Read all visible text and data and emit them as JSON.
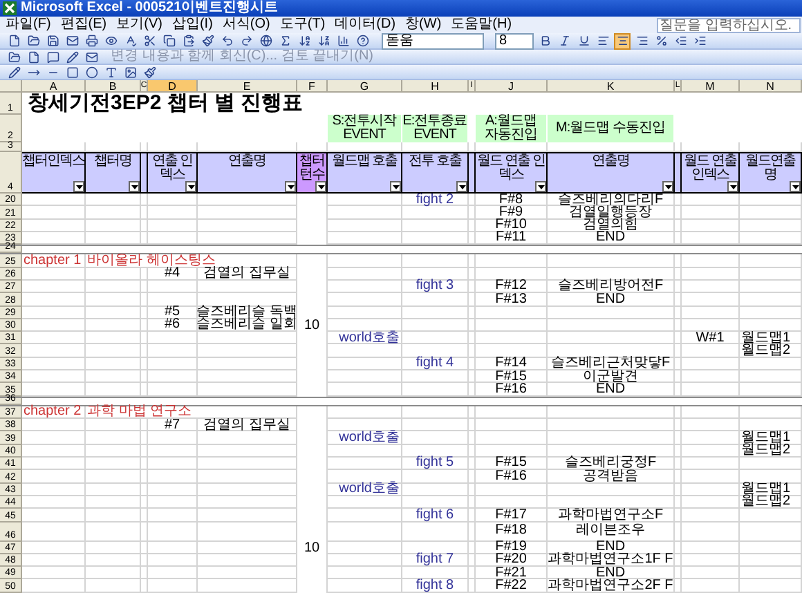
{
  "window": {
    "title": "Microsoft Excel - 000521이벤트진행시트"
  },
  "menu": [
    "파일(F)",
    "편집(E)",
    "보기(V)",
    "삽입(I)",
    "서식(O)",
    "도구(T)",
    "데이터(D)",
    "창(W)",
    "도움말(H)"
  ],
  "help_box": {
    "placeholder": "질문을 입력하십시오."
  },
  "formatting": {
    "font": "돋움",
    "size": "8",
    "align_center_active": true
  },
  "review_toolbar": {
    "reply": "변경 내용과 함께 회신(C)... 검토 끝내기(N)",
    "disabled": true
  },
  "columns": [
    {
      "label": "A",
      "selected": false
    },
    {
      "label": "B",
      "selected": false
    },
    {
      "label": "C",
      "selected": false
    },
    {
      "label": "D",
      "selected": true
    },
    {
      "label": "E",
      "selected": false
    },
    {
      "label": "F",
      "selected": false
    },
    {
      "label": "G",
      "selected": false
    },
    {
      "label": "H",
      "selected": false
    },
    {
      "label": "I",
      "selected": false
    },
    {
      "label": "J",
      "selected": false
    },
    {
      "label": "K",
      "selected": false
    },
    {
      "label": "L",
      "selected": false
    },
    {
      "label": "M",
      "selected": false
    },
    {
      "label": "N",
      "selected": false
    }
  ],
  "rows": [
    {
      "number": "1",
      "kind": "title",
      "cells": {
        "A": "창세기전3EP2 챕터 별 진행표"
      }
    },
    {
      "number": "2",
      "kind": "legend",
      "cells": {
        "G": "S:전투시작 EVENT",
        "H": "E:전투종료 EVENT",
        "J": "A:월드맵 자동진입",
        "K": "M:월드맵 수동진입"
      }
    },
    {
      "number": "3",
      "kind": "blank",
      "cells": {}
    },
    {
      "number": "4",
      "kind": "header",
      "cells": {
        "A": "챕터인덱스",
        "B": "챕터명",
        "D": "연출 인덱스",
        "E": "연출명",
        "F": "챕터턴수",
        "G": "월드맵 호출",
        "H": "전투 호출",
        "J": "월드 연출 인덱스",
        "K": "연출명",
        "M": "월드 연출 인덱스",
        "N": "월드연출명"
      }
    },
    {
      "number": "20",
      "kind": "normal",
      "cells": {
        "H": "fight 2",
        "J": "F#8",
        "K": "슬즈베리의다리F"
      }
    },
    {
      "number": "21",
      "kind": "normal",
      "cells": {
        "J": "F#9",
        "K": "검열일행등장"
      }
    },
    {
      "number": "22",
      "kind": "normal",
      "cells": {
        "J": "F#10",
        "K": "검열의힘"
      }
    },
    {
      "number": "23",
      "kind": "normal",
      "cells": {
        "J": "F#11",
        "K": "END"
      }
    },
    {
      "number": "24",
      "kind": "separator",
      "cells": {}
    },
    {
      "number": "25",
      "kind": "normal",
      "cells": {
        "A": "chapter 1",
        "B": "바이올라 헤이스팅스"
      }
    },
    {
      "number": "26",
      "kind": "normal",
      "cells": {
        "D": "#4",
        "E": "검열의 집무실"
      }
    },
    {
      "number": "27",
      "kind": "normal",
      "cells": {
        "H": "fight 3",
        "J": "F#12",
        "K": "슬즈베리방어전F"
      }
    },
    {
      "number": "28",
      "kind": "normal",
      "cells": {
        "J": "F#13",
        "K": "END"
      }
    },
    {
      "number": "29",
      "kind": "normal",
      "cells": {
        "D": "#5",
        "E": "슬즈베리슬 독백"
      }
    },
    {
      "number": "30",
      "kind": "normal",
      "cells": {
        "D": "#6",
        "E": "슬즈베리슬 일회",
        "F": "10"
      }
    },
    {
      "number": "31",
      "kind": "normal",
      "cells": {
        "G": "world호출",
        "M": "W#1",
        "N": "월드맵1"
      }
    },
    {
      "number": "32",
      "kind": "normal",
      "cells": {
        "N": "월드맵2"
      }
    },
    {
      "number": "33",
      "kind": "normal",
      "cells": {
        "H": "fight 4",
        "J": "F#14",
        "K": "슬즈베리근처맞닿F"
      }
    },
    {
      "number": "34",
      "kind": "normal",
      "cells": {
        "J": "F#15",
        "K": "이군발견"
      }
    },
    {
      "number": "35",
      "kind": "normal",
      "cells": {
        "J": "F#16",
        "K": "END"
      }
    },
    {
      "number": "36",
      "kind": "separator",
      "cells": {}
    },
    {
      "number": "37",
      "kind": "normal",
      "cells": {
        "A": "chapter 2",
        "B": "과학 마법 연구소"
      }
    },
    {
      "number": "38",
      "kind": "normal",
      "cells": {
        "D": "#7",
        "E": "검열의 집무실"
      }
    },
    {
      "number": "39",
      "kind": "normal",
      "cells": {
        "G": "world호출",
        "N": "월드맵1"
      }
    },
    {
      "number": "40",
      "kind": "normal",
      "cells": {
        "N": "월드맵2"
      }
    },
    {
      "number": "41",
      "kind": "normal",
      "cells": {
        "H": "fight 5",
        "J": "F#15",
        "K": "슬즈베리궁정F"
      }
    },
    {
      "number": "42",
      "kind": "normal",
      "cells": {
        "J": "F#16",
        "K": "공격받음"
      }
    },
    {
      "number": "43",
      "kind": "normal",
      "cells": {
        "G": "world호출",
        "N": "월드맵1"
      }
    },
    {
      "number": "44",
      "kind": "normal",
      "cells": {
        "N": "월드맵2"
      }
    },
    {
      "number": "45",
      "kind": "normal",
      "cells": {
        "H": "fight 6",
        "J": "F#17",
        "K": "과학마법연구소F"
      }
    },
    {
      "number": "46",
      "kind": "tall",
      "cells": {
        "J": "F#18",
        "K": "레이븐조우"
      }
    },
    {
      "number": "47",
      "kind": "normal",
      "cells": {
        "F": "10",
        "J": "F#19",
        "K": "END"
      }
    },
    {
      "number": "48",
      "kind": "normal",
      "cells": {
        "H": "fight 7",
        "J": "F#20",
        "K": "과학마법연구소1F F"
      }
    },
    {
      "number": "49",
      "kind": "normal",
      "cells": {
        "J": "F#21",
        "K": "END"
      }
    },
    {
      "number": "50",
      "kind": "normal",
      "cells": {
        "H": "fight 8",
        "J": "F#22",
        "K": "과학마법연구소2F F"
      }
    }
  ]
}
